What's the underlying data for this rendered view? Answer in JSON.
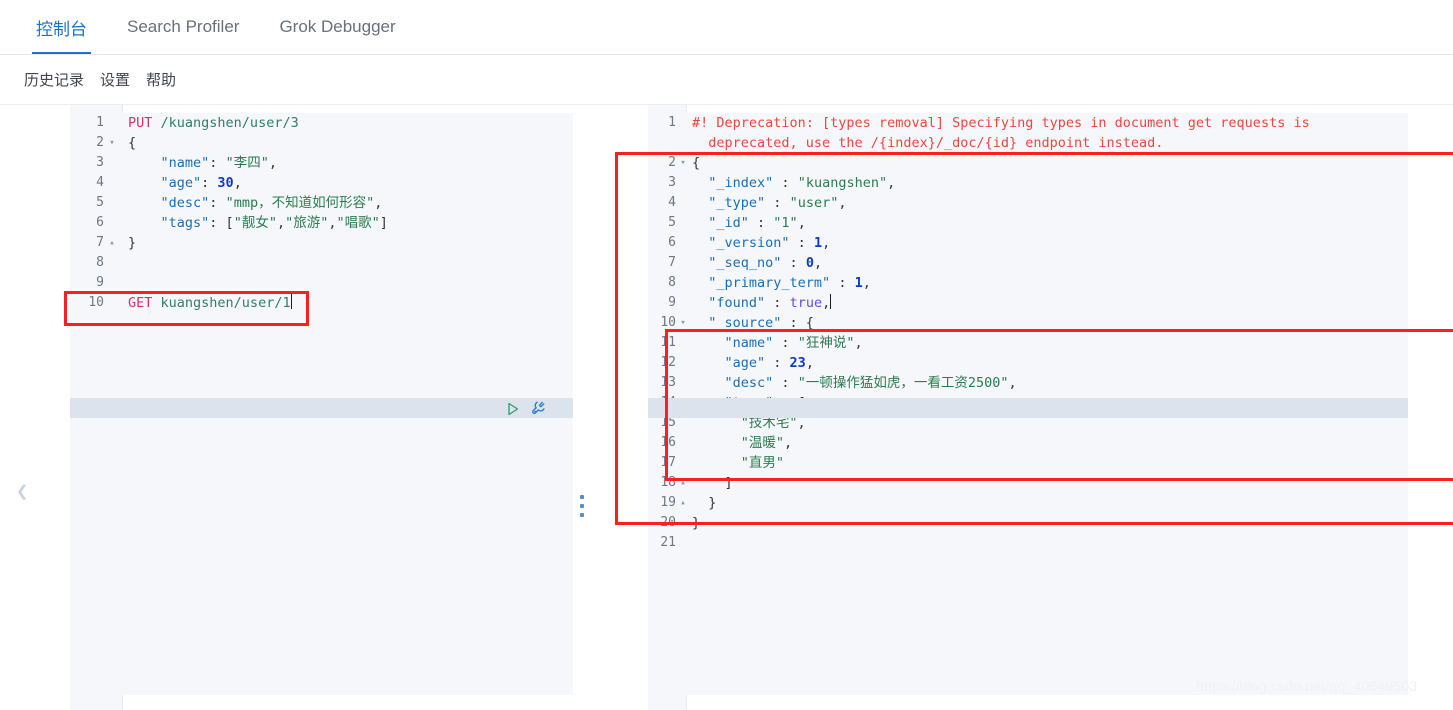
{
  "tabs": [
    {
      "label": "控制台",
      "active": true
    },
    {
      "label": "Search Profiler",
      "active": false
    },
    {
      "label": "Grok Debugger",
      "active": false
    }
  ],
  "submenu": [
    {
      "label": "历史记录"
    },
    {
      "label": "设置"
    },
    {
      "label": "帮助"
    }
  ],
  "request_editor": {
    "active_line": 10,
    "lines": [
      {
        "n": "1",
        "fold": "",
        "segments": [
          {
            "t": "PUT",
            "c": "k-method"
          },
          {
            "t": " ",
            "c": "k-plain"
          },
          {
            "t": "/kuangshen/user/3",
            "c": "k-url"
          }
        ]
      },
      {
        "n": "2",
        "fold": "▾",
        "segments": [
          {
            "t": "{",
            "c": "k-punc"
          }
        ]
      },
      {
        "n": "3",
        "fold": "",
        "segments": [
          {
            "t": "    ",
            "c": "k-plain"
          },
          {
            "t": "\"name\"",
            "c": "k-key"
          },
          {
            "t": ": ",
            "c": "k-punc"
          },
          {
            "t": "\"李四\"",
            "c": "k-str"
          },
          {
            "t": ",",
            "c": "k-punc"
          }
        ]
      },
      {
        "n": "4",
        "fold": "",
        "segments": [
          {
            "t": "    ",
            "c": "k-plain"
          },
          {
            "t": "\"age\"",
            "c": "k-key"
          },
          {
            "t": ": ",
            "c": "k-punc"
          },
          {
            "t": "30",
            "c": "k-num"
          },
          {
            "t": ",",
            "c": "k-punc"
          }
        ]
      },
      {
        "n": "5",
        "fold": "",
        "segments": [
          {
            "t": "    ",
            "c": "k-plain"
          },
          {
            "t": "\"desc\"",
            "c": "k-key"
          },
          {
            "t": ": ",
            "c": "k-punc"
          },
          {
            "t": "\"mmp，不知道如何形容\"",
            "c": "k-str"
          },
          {
            "t": ",",
            "c": "k-punc"
          }
        ]
      },
      {
        "n": "6",
        "fold": "",
        "segments": [
          {
            "t": "    ",
            "c": "k-plain"
          },
          {
            "t": "\"tags\"",
            "c": "k-key"
          },
          {
            "t": ": [",
            "c": "k-punc"
          },
          {
            "t": "\"靓女\"",
            "c": "k-str"
          },
          {
            "t": ",",
            "c": "k-punc"
          },
          {
            "t": "\"旅游\"",
            "c": "k-str"
          },
          {
            "t": ",",
            "c": "k-punc"
          },
          {
            "t": "\"唱歌\"",
            "c": "k-str"
          },
          {
            "t": "]",
            "c": "k-punc"
          }
        ]
      },
      {
        "n": "7",
        "fold": "▴",
        "segments": [
          {
            "t": "}",
            "c": "k-punc"
          }
        ]
      },
      {
        "n": "8",
        "fold": "",
        "segments": []
      },
      {
        "n": "9",
        "fold": "",
        "segments": []
      },
      {
        "n": "10",
        "fold": "",
        "segments": [
          {
            "t": "GET",
            "c": "k-method"
          },
          {
            "t": " ",
            "c": "k-plain"
          },
          {
            "t": "kuangshen/user/1",
            "c": "k-url"
          }
        ],
        "caret": true
      }
    ]
  },
  "response_editor": {
    "active_line": 9,
    "lines": [
      {
        "n": "1",
        "fold": "",
        "segments": [
          {
            "t": "#! Deprecation: [types removal] Specifying types in document get requests is",
            "c": "k-warn"
          }
        ]
      },
      {
        "n": "",
        "fold": "",
        "segments": [
          {
            "t": "  deprecated, use the /{index}/_doc/{id} endpoint instead.",
            "c": "k-warn"
          }
        ]
      },
      {
        "n": "2",
        "fold": "▾",
        "segments": [
          {
            "t": "{",
            "c": "k-punc"
          }
        ]
      },
      {
        "n": "3",
        "fold": "",
        "segments": [
          {
            "t": "  ",
            "c": "k-plain"
          },
          {
            "t": "\"_index\"",
            "c": "k-key"
          },
          {
            "t": " : ",
            "c": "k-punc"
          },
          {
            "t": "\"kuangshen\"",
            "c": "k-str"
          },
          {
            "t": ",",
            "c": "k-punc"
          }
        ]
      },
      {
        "n": "4",
        "fold": "",
        "segments": [
          {
            "t": "  ",
            "c": "k-plain"
          },
          {
            "t": "\"_type\"",
            "c": "k-key"
          },
          {
            "t": " : ",
            "c": "k-punc"
          },
          {
            "t": "\"user\"",
            "c": "k-str"
          },
          {
            "t": ",",
            "c": "k-punc"
          }
        ]
      },
      {
        "n": "5",
        "fold": "",
        "segments": [
          {
            "t": "  ",
            "c": "k-plain"
          },
          {
            "t": "\"_id\"",
            "c": "k-key"
          },
          {
            "t": " : ",
            "c": "k-punc"
          },
          {
            "t": "\"1\"",
            "c": "k-str"
          },
          {
            "t": ",",
            "c": "k-punc"
          }
        ]
      },
      {
        "n": "6",
        "fold": "",
        "segments": [
          {
            "t": "  ",
            "c": "k-plain"
          },
          {
            "t": "\"_version\"",
            "c": "k-key"
          },
          {
            "t": " : ",
            "c": "k-punc"
          },
          {
            "t": "1",
            "c": "k-num"
          },
          {
            "t": ",",
            "c": "k-punc"
          }
        ]
      },
      {
        "n": "7",
        "fold": "",
        "segments": [
          {
            "t": "  ",
            "c": "k-plain"
          },
          {
            "t": "\"_seq_no\"",
            "c": "k-key"
          },
          {
            "t": " : ",
            "c": "k-punc"
          },
          {
            "t": "0",
            "c": "k-num"
          },
          {
            "t": ",",
            "c": "k-punc"
          }
        ]
      },
      {
        "n": "8",
        "fold": "",
        "segments": [
          {
            "t": "  ",
            "c": "k-plain"
          },
          {
            "t": "\"_primary_term\"",
            "c": "k-key"
          },
          {
            "t": " : ",
            "c": "k-punc"
          },
          {
            "t": "1",
            "c": "k-num"
          },
          {
            "t": ",",
            "c": "k-punc"
          }
        ]
      },
      {
        "n": "9",
        "fold": "",
        "segments": [
          {
            "t": "  ",
            "c": "k-plain"
          },
          {
            "t": "\"found\"",
            "c": "k-key"
          },
          {
            "t": " : ",
            "c": "k-punc"
          },
          {
            "t": "true",
            "c": "k-bool"
          },
          {
            "t": ",",
            "c": "k-punc"
          }
        ],
        "caret": true
      },
      {
        "n": "10",
        "fold": "▾",
        "segments": [
          {
            "t": "  ",
            "c": "k-plain"
          },
          {
            "t": "\"_source\"",
            "c": "k-key"
          },
          {
            "t": " : {",
            "c": "k-punc"
          }
        ]
      },
      {
        "n": "11",
        "fold": "",
        "segments": [
          {
            "t": "    ",
            "c": "k-plain"
          },
          {
            "t": "\"name\"",
            "c": "k-key"
          },
          {
            "t": " : ",
            "c": "k-punc"
          },
          {
            "t": "\"狂神说\"",
            "c": "k-str"
          },
          {
            "t": ",",
            "c": "k-punc"
          }
        ]
      },
      {
        "n": "12",
        "fold": "",
        "segments": [
          {
            "t": "    ",
            "c": "k-plain"
          },
          {
            "t": "\"age\"",
            "c": "k-key"
          },
          {
            "t": " : ",
            "c": "k-punc"
          },
          {
            "t": "23",
            "c": "k-num"
          },
          {
            "t": ",",
            "c": "k-punc"
          }
        ]
      },
      {
        "n": "13",
        "fold": "",
        "segments": [
          {
            "t": "    ",
            "c": "k-plain"
          },
          {
            "t": "\"desc\"",
            "c": "k-key"
          },
          {
            "t": " : ",
            "c": "k-punc"
          },
          {
            "t": "\"一顿操作猛如虎，一看工资2500\"",
            "c": "k-str"
          },
          {
            "t": ",",
            "c": "k-punc"
          }
        ]
      },
      {
        "n": "14",
        "fold": "▾",
        "segments": [
          {
            "t": "    ",
            "c": "k-plain"
          },
          {
            "t": "\"tags\"",
            "c": "k-key"
          },
          {
            "t": " : [",
            "c": "k-punc"
          }
        ]
      },
      {
        "n": "15",
        "fold": "",
        "segments": [
          {
            "t": "      ",
            "c": "k-plain"
          },
          {
            "t": "\"技术宅\"",
            "c": "k-str"
          },
          {
            "t": ",",
            "c": "k-punc"
          }
        ]
      },
      {
        "n": "16",
        "fold": "",
        "segments": [
          {
            "t": "      ",
            "c": "k-plain"
          },
          {
            "t": "\"温暖\"",
            "c": "k-str"
          },
          {
            "t": ",",
            "c": "k-punc"
          }
        ]
      },
      {
        "n": "17",
        "fold": "",
        "segments": [
          {
            "t": "      ",
            "c": "k-plain"
          },
          {
            "t": "\"直男\"",
            "c": "k-str"
          }
        ]
      },
      {
        "n": "18",
        "fold": "▴",
        "segments": [
          {
            "t": "    ]",
            "c": "k-punc"
          }
        ]
      },
      {
        "n": "19",
        "fold": "▴",
        "segments": [
          {
            "t": "  }",
            "c": "k-punc"
          }
        ]
      },
      {
        "n": "20",
        "fold": "",
        "segments": [
          {
            "t": "}",
            "c": "k-punc"
          }
        ]
      },
      {
        "n": "21",
        "fold": "",
        "segments": []
      }
    ]
  },
  "icons": {
    "play": "play-icon",
    "wrench": "wrench-icon",
    "collapse": "chevron-left-icon",
    "splitter": "drag-handle-icon"
  },
  "colors": {
    "accent": "#1a73c9",
    "annotation": "#fa2020",
    "editor_bg": "#f5f7fa",
    "active_line": "#dde3ec",
    "warning": "#e8483f"
  },
  "watermark": "https://blog.csdn.net/qq_40649503"
}
